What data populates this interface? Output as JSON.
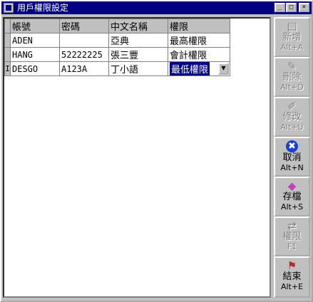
{
  "window": {
    "title": "用戶權限設定"
  },
  "titlebar_buttons": {
    "minimize": "_",
    "maximize": "□",
    "close": "×"
  },
  "grid": {
    "columns": [
      "帳號",
      "密碼",
      "中文名稱",
      "權限"
    ],
    "rows": [
      [
        "ADEN",
        "",
        "亞典",
        "最高權限"
      ],
      [
        "HANG",
        "52222225",
        "張三豐",
        "會計權限"
      ],
      [
        "DESGO",
        "A123A",
        "丁小語",
        "最低權限"
      ]
    ],
    "current_row_indicator": "I",
    "dropdown_arrow": "▼"
  },
  "buttons": [
    {
      "label": "新增",
      "shortcut": "Alt+A",
      "enabled": false,
      "icon": "add-record-icon"
    },
    {
      "label": "刪除",
      "shortcut": "Alt+D",
      "enabled": false,
      "icon": "delete-icon"
    },
    {
      "label": "修改",
      "shortcut": "Alt+U",
      "enabled": false,
      "icon": "edit-icon"
    },
    {
      "label": "取消",
      "shortcut": "Alt+N",
      "enabled": true,
      "icon": "cancel-icon"
    },
    {
      "label": "存檔",
      "shortcut": "Alt+S",
      "enabled": true,
      "icon": "save-icon"
    },
    {
      "label": "權限",
      "shortcut": "F1",
      "enabled": false,
      "icon": "permission-icon"
    },
    {
      "label": "結束",
      "shortcut": "Alt+E",
      "enabled": true,
      "icon": "exit-icon"
    }
  ],
  "colors": {
    "titlebar": "#000080",
    "face": "#c0c0c0",
    "selection": "#000080"
  }
}
